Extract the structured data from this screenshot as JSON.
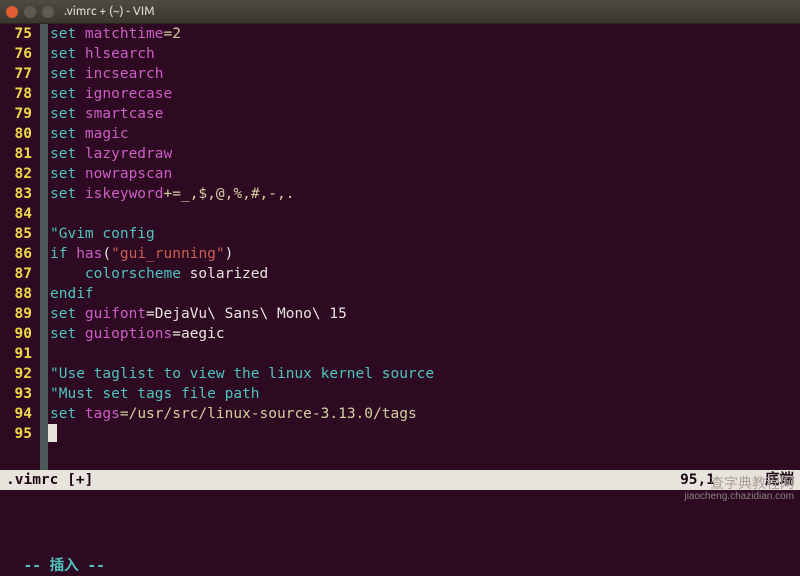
{
  "window": {
    "title": ".vimrc + (~) - VIM"
  },
  "gutter": {
    "start": 75,
    "end": 95
  },
  "code": {
    "rows": [
      {
        "n": 75,
        "t": "set",
        "o": " matchtime",
        "rest": "=",
        "tail": "2",
        "tailClass": "num"
      },
      {
        "n": 76,
        "t": "set",
        "o": " hlsearch"
      },
      {
        "n": 77,
        "t": "set",
        "o": " incsearch"
      },
      {
        "n": 78,
        "t": "set",
        "o": " ignorecase"
      },
      {
        "n": 79,
        "t": "set",
        "o": " smartcase"
      },
      {
        "n": 80,
        "t": "set",
        "o": " magic"
      },
      {
        "n": 81,
        "t": "set",
        "o": " lazyredraw"
      },
      {
        "n": 82,
        "t": "set",
        "o": " nowrapscan"
      },
      {
        "n": 83,
        "t": "set",
        "o": " iskeyword",
        "rest": "+=_,$,@,%,#,-,.",
        "tailClass": "num"
      },
      {
        "n": 84,
        "blank": true
      },
      {
        "n": 85,
        "comment": "\"Gvim config"
      },
      {
        "n": 86,
        "t": "if ",
        "call": "has",
        "paren": "(",
        "str": "\"gui_running\"",
        "paren2": ")"
      },
      {
        "n": 87,
        "indent": "    ",
        "t": "colorscheme",
        "plain": " solarized"
      },
      {
        "n": 88,
        "t": "endif"
      },
      {
        "n": 89,
        "t": "set",
        "o": " guifont",
        "rest": "=DejaVu\\ Sans\\ Mono\\ 15",
        "tailClass": "id"
      },
      {
        "n": 90,
        "t": "set",
        "o": " guioptions",
        "rest": "=aegic",
        "tailClass": "id"
      },
      {
        "n": 91,
        "blank": true
      },
      {
        "n": 92,
        "comment": "\"Use taglist to view the linux kernel source"
      },
      {
        "n": 93,
        "comment": "\"Must set tags file path"
      },
      {
        "n": 94,
        "t": "set",
        "o": " tags",
        "rest": "=/usr/src/linux-source-3.13.0/tags",
        "tailClass": "path"
      },
      {
        "n": 95,
        "blank": true
      }
    ]
  },
  "statusline": {
    "file": ".vimrc [+]",
    "pos": "95,1",
    "end": "底端"
  },
  "cmd": {
    "mode": "-- 插入 --"
  },
  "watermark": {
    "line1": "查字典教程网",
    "line2": "jiaocheng.chazidian.com"
  }
}
